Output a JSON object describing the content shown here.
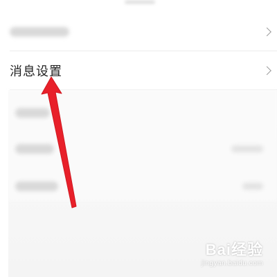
{
  "settings_list": {
    "message_settings_label": "消息设置"
  },
  "watermark": {
    "logo_text": "Bai经验",
    "url_text": "jingyan.baidu.com"
  },
  "colors": {
    "arrow": "#e8202a",
    "chevron": "#9b9b9b",
    "divider": "#ececec",
    "label_text": "#222222"
  },
  "icons": {
    "row_chevron": "chevron-right-icon",
    "annotation": "red-arrow-icon"
  }
}
